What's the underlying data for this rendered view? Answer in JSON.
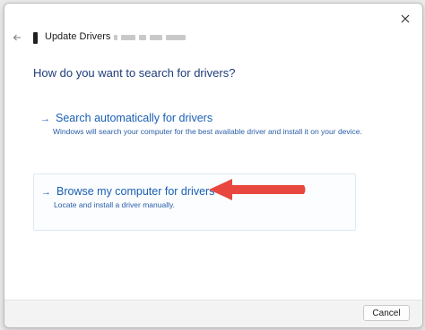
{
  "window": {
    "title": "Update Drivers -",
    "close_icon": "close-icon",
    "back_icon": "back-arrow-icon"
  },
  "heading": "How do you want to search for drivers?",
  "options": [
    {
      "arrow": "→",
      "title": "Search automatically for drivers",
      "description": "Windows will search your computer for the best available driver and install it on your device."
    },
    {
      "arrow": "→",
      "title": "Browse my computer for drivers",
      "description": "Locate and install a driver manually."
    }
  ],
  "footer": {
    "cancel_label": "Cancel"
  },
  "colors": {
    "heading": "#1f3d7a",
    "link": "#1a5fb4",
    "annotation_arrow": "#e8473f"
  }
}
